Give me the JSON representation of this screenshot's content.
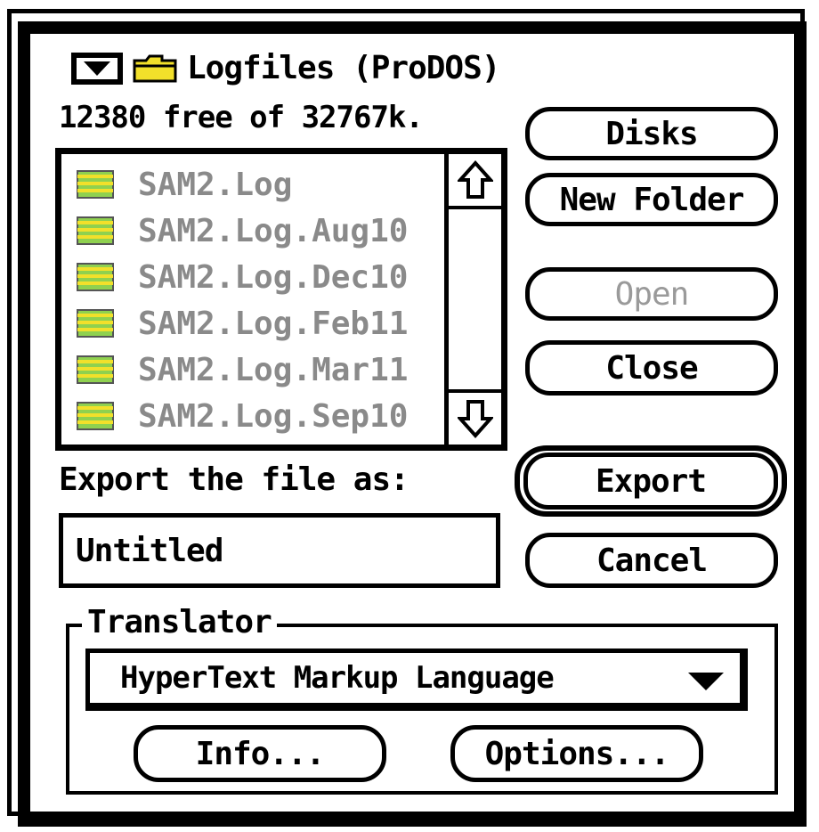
{
  "folder": {
    "name": "Logfiles (ProDOS)",
    "free_space": "12380 free of 32767k."
  },
  "files": [
    "SAM2.Log",
    "SAM2.Log.Aug10",
    "SAM2.Log.Dec10",
    "SAM2.Log.Feb11",
    "SAM2.Log.Mar11",
    "SAM2.Log.Sep10"
  ],
  "buttons": {
    "disks": "Disks",
    "new_folder": "New Folder",
    "open": "Open",
    "close": "Close",
    "export": "Export",
    "cancel": "Cancel",
    "info": "Info...",
    "options": "Options..."
  },
  "export": {
    "label": "Export the file as:",
    "filename": "Untitled"
  },
  "translator": {
    "label": "Translator",
    "selected": "HyperText Markup Language"
  },
  "colors": {
    "file_icon_green": "#8fd14f",
    "file_icon_yellow": "#f2e02a",
    "disabled_text": "#9a9a9a"
  }
}
